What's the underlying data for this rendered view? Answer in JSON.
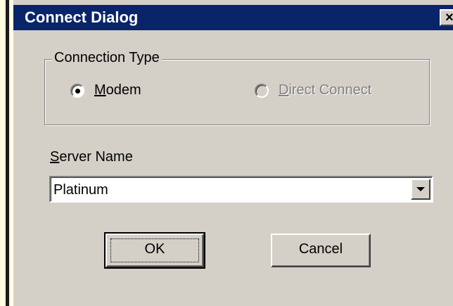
{
  "window": {
    "title": "Connect Dialog",
    "close_glyph": "×"
  },
  "connection_type": {
    "legend": "Connection Type",
    "options": [
      {
        "label": "Modem",
        "accel": "M",
        "rest": "odem",
        "selected": true,
        "enabled": true
      },
      {
        "label": "Direct Connect",
        "accel": "D",
        "rest": "irect Connect",
        "selected": false,
        "enabled": false
      }
    ]
  },
  "server": {
    "label": "Server Name",
    "label_accel": "S",
    "label_rest": "erver Name",
    "value": "Platinum"
  },
  "buttons": {
    "ok_label": "OK",
    "cancel_label": "Cancel"
  },
  "colors": {
    "title_bar": "#0a246a",
    "dialog_face": "#d4d0c8",
    "page_background": "#fffde0"
  }
}
